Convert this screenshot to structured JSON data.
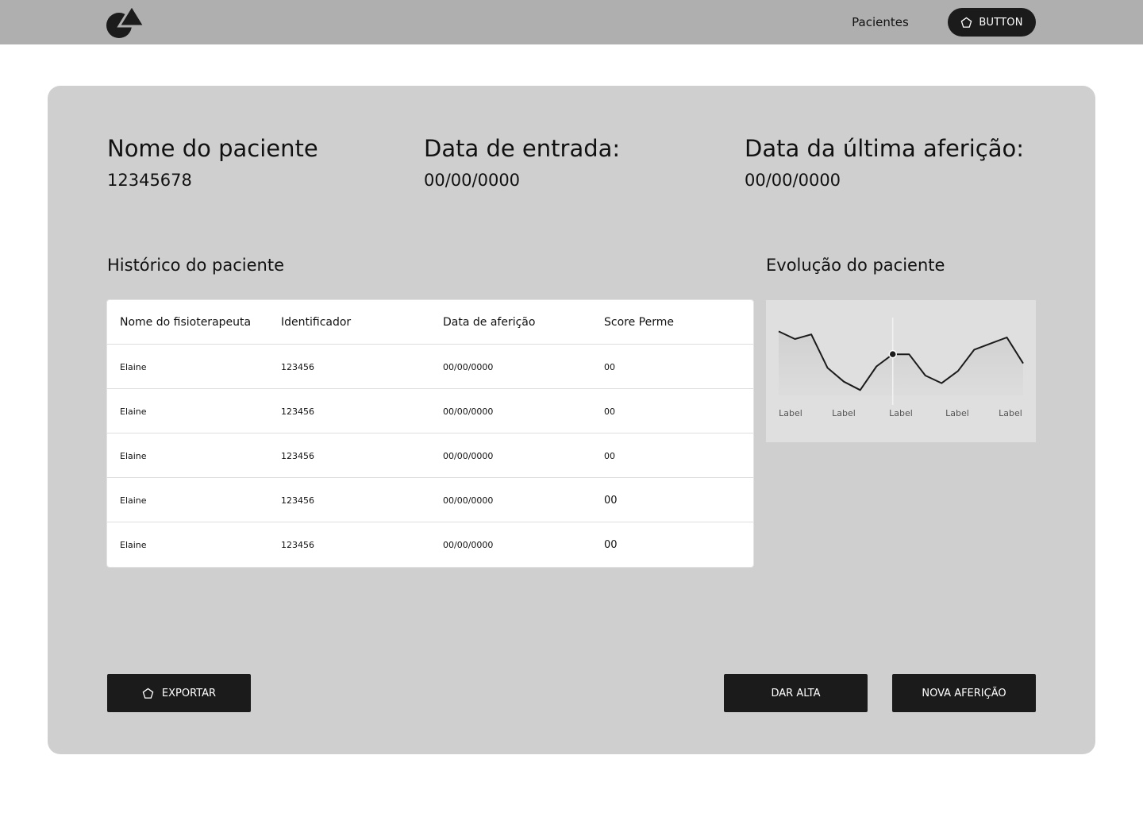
{
  "nav": {
    "logo": "logo-mark",
    "link_label": "Pacientes",
    "button_label": "BUTTON",
    "button_icon": "pentagon-icon"
  },
  "patient": {
    "name_title": "Nome do paciente",
    "id_value": "12345678",
    "entry_title": "Data de entrada:",
    "entry_value": "00/00/0000",
    "last_title": "Data da última aferição:",
    "last_value": "00/00/0000"
  },
  "history": {
    "title": "Histórico do paciente",
    "columns": [
      "Nome do fisioterapeuta",
      "Identificador",
      "Data de aferição",
      "Score Perme"
    ],
    "rows": [
      [
        "Elaine",
        "123456",
        "00/00/0000",
        "00"
      ],
      [
        "Elaine",
        "123456",
        "00/00/0000",
        "00"
      ],
      [
        "Elaine",
        "123456",
        "00/00/0000",
        "00"
      ],
      [
        "Elaine",
        "123456",
        "00/00/0000",
        "00"
      ],
      [
        "Elaine",
        "123456",
        "00/00/0000",
        "00"
      ]
    ]
  },
  "evolution": {
    "title": "Evolução do paciente"
  },
  "chart_data": {
    "type": "line",
    "title": "",
    "xlabel": "",
    "ylabel": "",
    "x_tick_labels": [
      "Label",
      "Label",
      "Label",
      "Label",
      "Label"
    ],
    "series": [
      {
        "values": [
          84,
          74,
          80,
          36,
          18,
          7,
          38,
          54,
          54,
          26,
          16,
          32,
          60,
          68,
          76,
          42
        ]
      }
    ],
    "ylim": [
      0,
      100
    ],
    "highlighted_point_index": 7,
    "grid": false,
    "legend": "none",
    "colors": {
      "line": "#1b1b1b",
      "fill": "#cfcfcf",
      "background": "#dfdfdf"
    }
  },
  "actions": {
    "export_label": "EXPORTAR",
    "export_icon": "pentagon-icon",
    "discharge_label": "DAR ALTA",
    "new_measure_label": "NOVA AFERIÇÃO"
  },
  "colors": {
    "topbar": "#afafaf",
    "card": "#d0cfd0",
    "dark": "#1b1b1b",
    "table_bg": "#ffffff"
  }
}
